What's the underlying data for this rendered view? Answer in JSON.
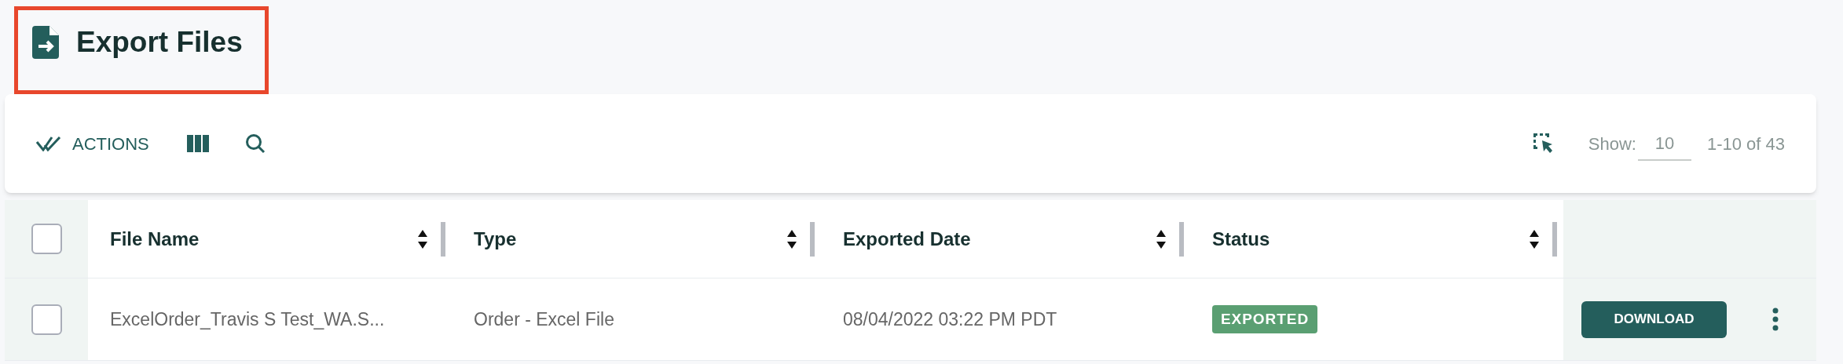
{
  "page": {
    "title": "Export Files",
    "highlighted": true
  },
  "toolbar": {
    "actions_label": "ACTIONS",
    "show_label": "Show:",
    "page_size": "10",
    "range": "1-10 of 43"
  },
  "table": {
    "select_all_checked": false,
    "columns": [
      {
        "label": "File Name"
      },
      {
        "label": "Type"
      },
      {
        "label": "Exported Date"
      },
      {
        "label": "Status"
      }
    ],
    "rows": [
      {
        "checked": false,
        "file_name": "ExcelOrder_Travis S Test_WA.S...",
        "type": "Order - Excel File",
        "exported_date": "08/04/2022 03:22 PM PDT",
        "status": "EXPORTED",
        "action": "DOWNLOAD"
      }
    ]
  }
}
